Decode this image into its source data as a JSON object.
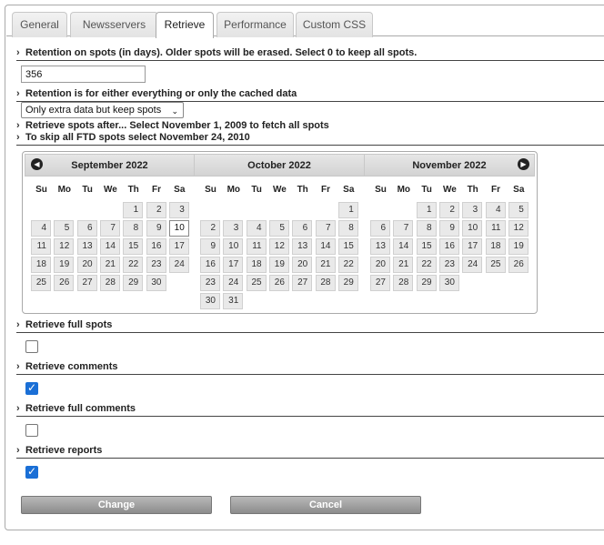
{
  "tabs": [
    "General",
    "Newsservers",
    "Retrieve",
    "Performance",
    "Custom CSS"
  ],
  "active_tab": "Retrieve",
  "retention": {
    "label": "Retention on spots (in days). Older spots will be erased. Select 0 to keep all spots.",
    "value": "356"
  },
  "retention_scope": {
    "label": "Retention is for either everything or only the cached data",
    "selected": "Only extra data but keep spots"
  },
  "retrieve_after": {
    "label": "Retrieve spots after... Select November 1, 2009 to fetch all spots",
    "label2": "To skip all FTD spots select November 24, 2010"
  },
  "calendar": {
    "weekdays": [
      "Su",
      "Mo",
      "Tu",
      "We",
      "Th",
      "Fr",
      "Sa"
    ],
    "months": [
      {
        "title": "September 2022"
      },
      {
        "title": "October 2022"
      },
      {
        "title": "November 2022"
      }
    ],
    "selected_day": "10"
  },
  "options": [
    {
      "label": "Retrieve full spots",
      "checked": false
    },
    {
      "label": "Retrieve comments",
      "checked": true
    },
    {
      "label": "Retrieve full comments",
      "checked": false
    },
    {
      "label": "Retrieve reports",
      "checked": true
    }
  ],
  "buttons": {
    "change": "Change",
    "cancel": "Cancel"
  },
  "icons": {
    "prev": "chevron-left-icon",
    "next": "chevron-right-icon",
    "caret": "caret-right-icon"
  },
  "colors": {
    "accent": "#1a6fd6",
    "button": "#9e9e9e"
  }
}
